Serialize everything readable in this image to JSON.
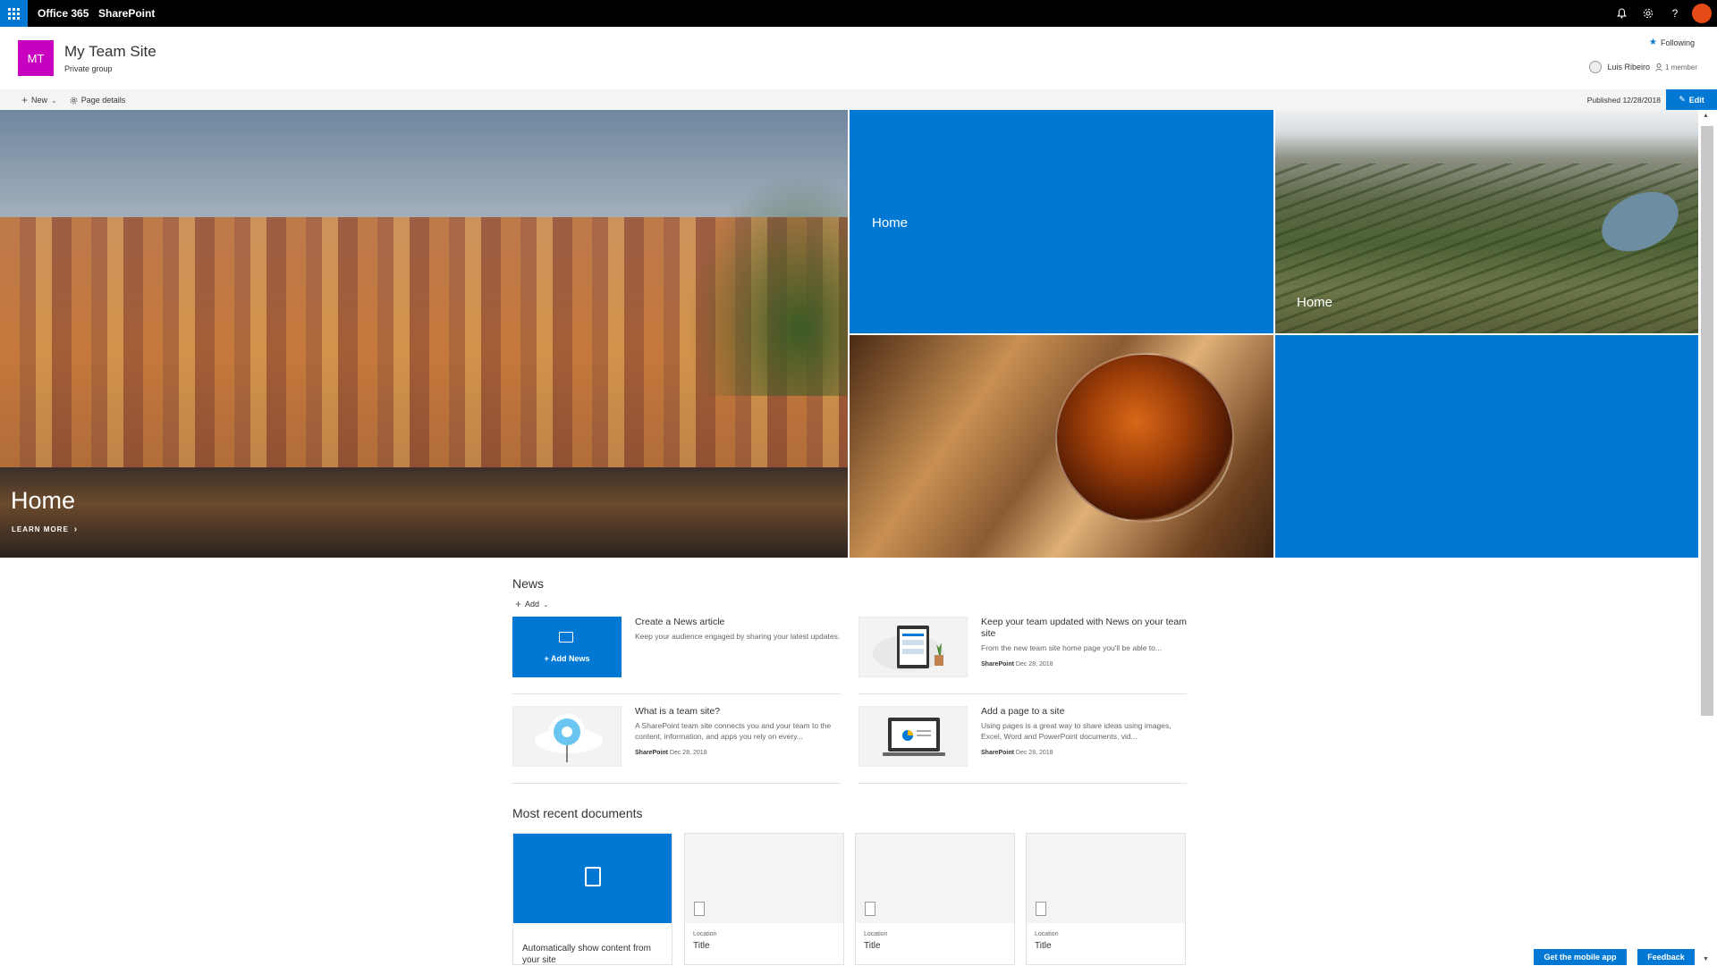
{
  "suitebar": {
    "brand": "Office 365",
    "app": "SharePoint",
    "icons": [
      "waffle-icon",
      "bell-icon",
      "gear-icon",
      "help-icon"
    ]
  },
  "site": {
    "logo_initials": "MT",
    "title": "My Team Site",
    "description": "Private group",
    "following_label": "Following",
    "user_name": "Luis Ribeiro",
    "member_count": "1 member",
    "logo_color": "#c800c0"
  },
  "commandbar": {
    "new_label": "New",
    "page_details_label": "Page details",
    "published": "Published 12/28/2018",
    "edit_label": "Edit"
  },
  "hero": {
    "main_title": "Home",
    "main_link": "LEARN MORE",
    "tile2_title": "Home",
    "tile3_title": "Home",
    "accent": "#0078d4"
  },
  "news": {
    "title": "News",
    "add_label": "Add",
    "add_news_label": "Add News",
    "items": [
      {
        "title": "Create a News article",
        "desc": "Keep your audience engaged by sharing your latest updates.",
        "author": "",
        "date": ""
      },
      {
        "title": "Keep your team updated with News on your team site",
        "desc": "From the new team site home page you'll be able to...",
        "author": "SharePoint",
        "date": "Dec 28, 2018"
      },
      {
        "title": "What is a team site?",
        "desc": "A SharePoint team site connects you and your team to the content, information, and apps you rely on every...",
        "author": "SharePoint",
        "date": "Dec 28, 2018"
      },
      {
        "title": "Add a page to a site",
        "desc": "Using pages is a great way to share ideas using images, Excel, Word and PowerPoint documents, vid...",
        "author": "SharePoint",
        "date": "Dec 28, 2018"
      }
    ]
  },
  "documents": {
    "title": "Most recent documents",
    "auto_label": "Automatically show content from your site",
    "cards": [
      {
        "location": "Location",
        "title": "Title"
      },
      {
        "location": "Location",
        "title": "Title"
      },
      {
        "location": "Location",
        "title": "Title"
      }
    ]
  },
  "footer": {
    "mobile_app": "Get the mobile app",
    "feedback": "Feedback"
  }
}
